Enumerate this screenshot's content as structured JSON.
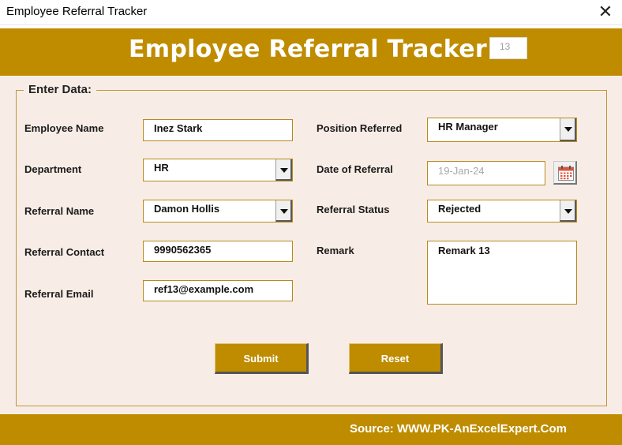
{
  "window": {
    "title": "Employee Referral Tracker",
    "close_glyph": "✕"
  },
  "header": {
    "title": "Employee Referral Tracker",
    "record_id": "13"
  },
  "form": {
    "legend": "Enter Data:",
    "employee_name": {
      "label": "Employee Name",
      "value": "Inez Stark"
    },
    "department": {
      "label": "Department",
      "value": "HR"
    },
    "referral_name": {
      "label": "Referral Name",
      "value": "Damon Hollis"
    },
    "referral_contact": {
      "label": "Referral Contact",
      "value": "9990562365"
    },
    "referral_email": {
      "label": "Referral Email",
      "value": "ref13@example.com"
    },
    "position_referred": {
      "label": "Position Referred",
      "value": "HR Manager"
    },
    "date_of_referral": {
      "label": "Date of Referral",
      "value": "19-Jan-24"
    },
    "referral_status": {
      "label": "Referral Status",
      "value": "Rejected"
    },
    "remark": {
      "label": "Remark",
      "value": "Remark 13"
    }
  },
  "buttons": {
    "submit": "Submit",
    "reset": "Reset"
  },
  "footer": {
    "source": "Source: WWW.PK-AnExcelExpert.Com"
  },
  "colors": {
    "accent": "#bf8c00",
    "body_bg": "#f8ede6",
    "field_border": "#b88a1c"
  },
  "icons": {
    "close": "close-icon",
    "calendar": "calendar-icon",
    "dropdown": "chevron-down-icon"
  }
}
